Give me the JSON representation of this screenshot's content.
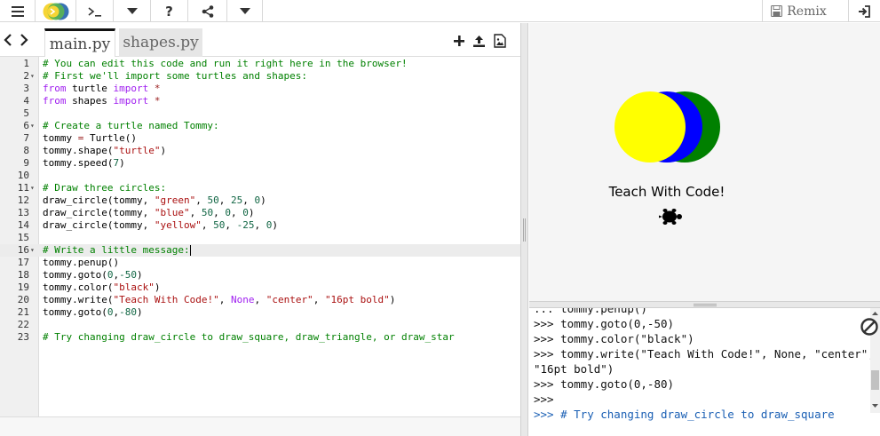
{
  "toolbar": {
    "remix_label": "Remix"
  },
  "tabs": [
    {
      "label": "main.py",
      "active": true
    },
    {
      "label": "shapes.py",
      "active": false
    }
  ],
  "editor": {
    "lines": [
      {
        "n": "1",
        "fold": "",
        "tokens": [
          {
            "t": "# You can edit this code and run it right here in the browser!",
            "c": "comment"
          }
        ]
      },
      {
        "n": "2",
        "fold": "▾",
        "tokens": [
          {
            "t": "# First we'll import some turtles and shapes:",
            "c": "comment"
          }
        ]
      },
      {
        "n": "3",
        "fold": "",
        "tokens": [
          {
            "t": "from",
            "c": "kw"
          },
          {
            "t": " turtle ",
            "c": ""
          },
          {
            "t": "import",
            "c": "kw"
          },
          {
            "t": " *",
            "c": "op"
          }
        ]
      },
      {
        "n": "4",
        "fold": "",
        "tokens": [
          {
            "t": "from",
            "c": "kw"
          },
          {
            "t": " shapes ",
            "c": ""
          },
          {
            "t": "import",
            "c": "kw"
          },
          {
            "t": " *",
            "c": "op"
          }
        ]
      },
      {
        "n": "5",
        "fold": "",
        "tokens": []
      },
      {
        "n": "6",
        "fold": "▾",
        "tokens": [
          {
            "t": "# Create a turtle named Tommy:",
            "c": "comment"
          }
        ]
      },
      {
        "n": "7",
        "fold": "",
        "tokens": [
          {
            "t": "tommy ",
            "c": ""
          },
          {
            "t": "=",
            "c": "op"
          },
          {
            "t": " Turtle()",
            "c": ""
          }
        ]
      },
      {
        "n": "8",
        "fold": "",
        "tokens": [
          {
            "t": "tommy.shape(",
            "c": ""
          },
          {
            "t": "\"turtle\"",
            "c": "str"
          },
          {
            "t": ")",
            "c": ""
          }
        ]
      },
      {
        "n": "9",
        "fold": "",
        "tokens": [
          {
            "t": "tommy.speed(",
            "c": ""
          },
          {
            "t": "7",
            "c": "num"
          },
          {
            "t": ")",
            "c": ""
          }
        ]
      },
      {
        "n": "10",
        "fold": "",
        "tokens": []
      },
      {
        "n": "11",
        "fold": "▾",
        "tokens": [
          {
            "t": "# Draw three circles:",
            "c": "comment"
          }
        ]
      },
      {
        "n": "12",
        "fold": "",
        "tokens": [
          {
            "t": "draw_circle(tommy, ",
            "c": ""
          },
          {
            "t": "\"green\"",
            "c": "str"
          },
          {
            "t": ", ",
            "c": ""
          },
          {
            "t": "50",
            "c": "num"
          },
          {
            "t": ", ",
            "c": ""
          },
          {
            "t": "25",
            "c": "num"
          },
          {
            "t": ", ",
            "c": ""
          },
          {
            "t": "0",
            "c": "num"
          },
          {
            "t": ")",
            "c": ""
          }
        ]
      },
      {
        "n": "13",
        "fold": "",
        "tokens": [
          {
            "t": "draw_circle(tommy, ",
            "c": ""
          },
          {
            "t": "\"blue\"",
            "c": "str"
          },
          {
            "t": ", ",
            "c": ""
          },
          {
            "t": "50",
            "c": "num"
          },
          {
            "t": ", ",
            "c": ""
          },
          {
            "t": "0",
            "c": "num"
          },
          {
            "t": ", ",
            "c": ""
          },
          {
            "t": "0",
            "c": "num"
          },
          {
            "t": ")",
            "c": ""
          }
        ]
      },
      {
        "n": "14",
        "fold": "",
        "tokens": [
          {
            "t": "draw_circle(tommy, ",
            "c": ""
          },
          {
            "t": "\"yellow\"",
            "c": "str"
          },
          {
            "t": ", ",
            "c": ""
          },
          {
            "t": "50",
            "c": "num"
          },
          {
            "t": ", ",
            "c": ""
          },
          {
            "t": "-25",
            "c": "num"
          },
          {
            "t": ", ",
            "c": ""
          },
          {
            "t": "0",
            "c": "num"
          },
          {
            "t": ")",
            "c": ""
          }
        ]
      },
      {
        "n": "15",
        "fold": "",
        "tokens": []
      },
      {
        "n": "16",
        "fold": "▾",
        "active": true,
        "tokens": [
          {
            "t": "# Write a little message:",
            "c": "comment"
          }
        ]
      },
      {
        "n": "17",
        "fold": "",
        "tokens": [
          {
            "t": "tommy.penup()",
            "c": ""
          }
        ]
      },
      {
        "n": "18",
        "fold": "",
        "tokens": [
          {
            "t": "tommy.goto(",
            "c": ""
          },
          {
            "t": "0",
            "c": "num"
          },
          {
            "t": ",",
            "c": ""
          },
          {
            "t": "-50",
            "c": "num"
          },
          {
            "t": ")",
            "c": ""
          }
        ]
      },
      {
        "n": "19",
        "fold": "",
        "tokens": [
          {
            "t": "tommy.color(",
            "c": ""
          },
          {
            "t": "\"black\"",
            "c": "str"
          },
          {
            "t": ")",
            "c": ""
          }
        ]
      },
      {
        "n": "20",
        "fold": "",
        "tokens": [
          {
            "t": "tommy.write(",
            "c": ""
          },
          {
            "t": "\"Teach With Code!\"",
            "c": "str"
          },
          {
            "t": ", ",
            "c": ""
          },
          {
            "t": "None",
            "c": "kw"
          },
          {
            "t": ", ",
            "c": ""
          },
          {
            "t": "\"center\"",
            "c": "str"
          },
          {
            "t": ", ",
            "c": ""
          },
          {
            "t": "\"16pt bold\"",
            "c": "str"
          },
          {
            "t": ")",
            "c": ""
          }
        ]
      },
      {
        "n": "21",
        "fold": "",
        "tokens": [
          {
            "t": "tommy.goto(",
            "c": ""
          },
          {
            "t": "0",
            "c": "num"
          },
          {
            "t": ",",
            "c": ""
          },
          {
            "t": "-80",
            "c": "num"
          },
          {
            "t": ")",
            "c": ""
          }
        ]
      },
      {
        "n": "22",
        "fold": "",
        "tokens": []
      },
      {
        "n": "23",
        "fold": "",
        "tokens": [
          {
            "t": "# Try changing draw_circle to draw_square, draw_triangle, or draw_star",
            "c": "comment"
          }
        ]
      }
    ]
  },
  "canvas": {
    "message": "Teach With Code!",
    "circle_colors": [
      "#008000",
      "#0000ff",
      "#ffff00"
    ]
  },
  "console": {
    "lines": [
      "... tommy.penup()",
      ">>> tommy.goto(0,-50)",
      ">>> tommy.color(\"black\")",
      ">>> tommy.write(\"Teach With Code!\", None, \"center\",",
      "\"16pt bold\")",
      ">>> tommy.goto(0,-80)",
      ">>>",
      ">>> # Try changing draw_circle to draw_square"
    ]
  },
  "colors": {
    "comment": "#008000",
    "keyword": "#a020f0",
    "string": "#aa1111",
    "number": "#116644"
  }
}
